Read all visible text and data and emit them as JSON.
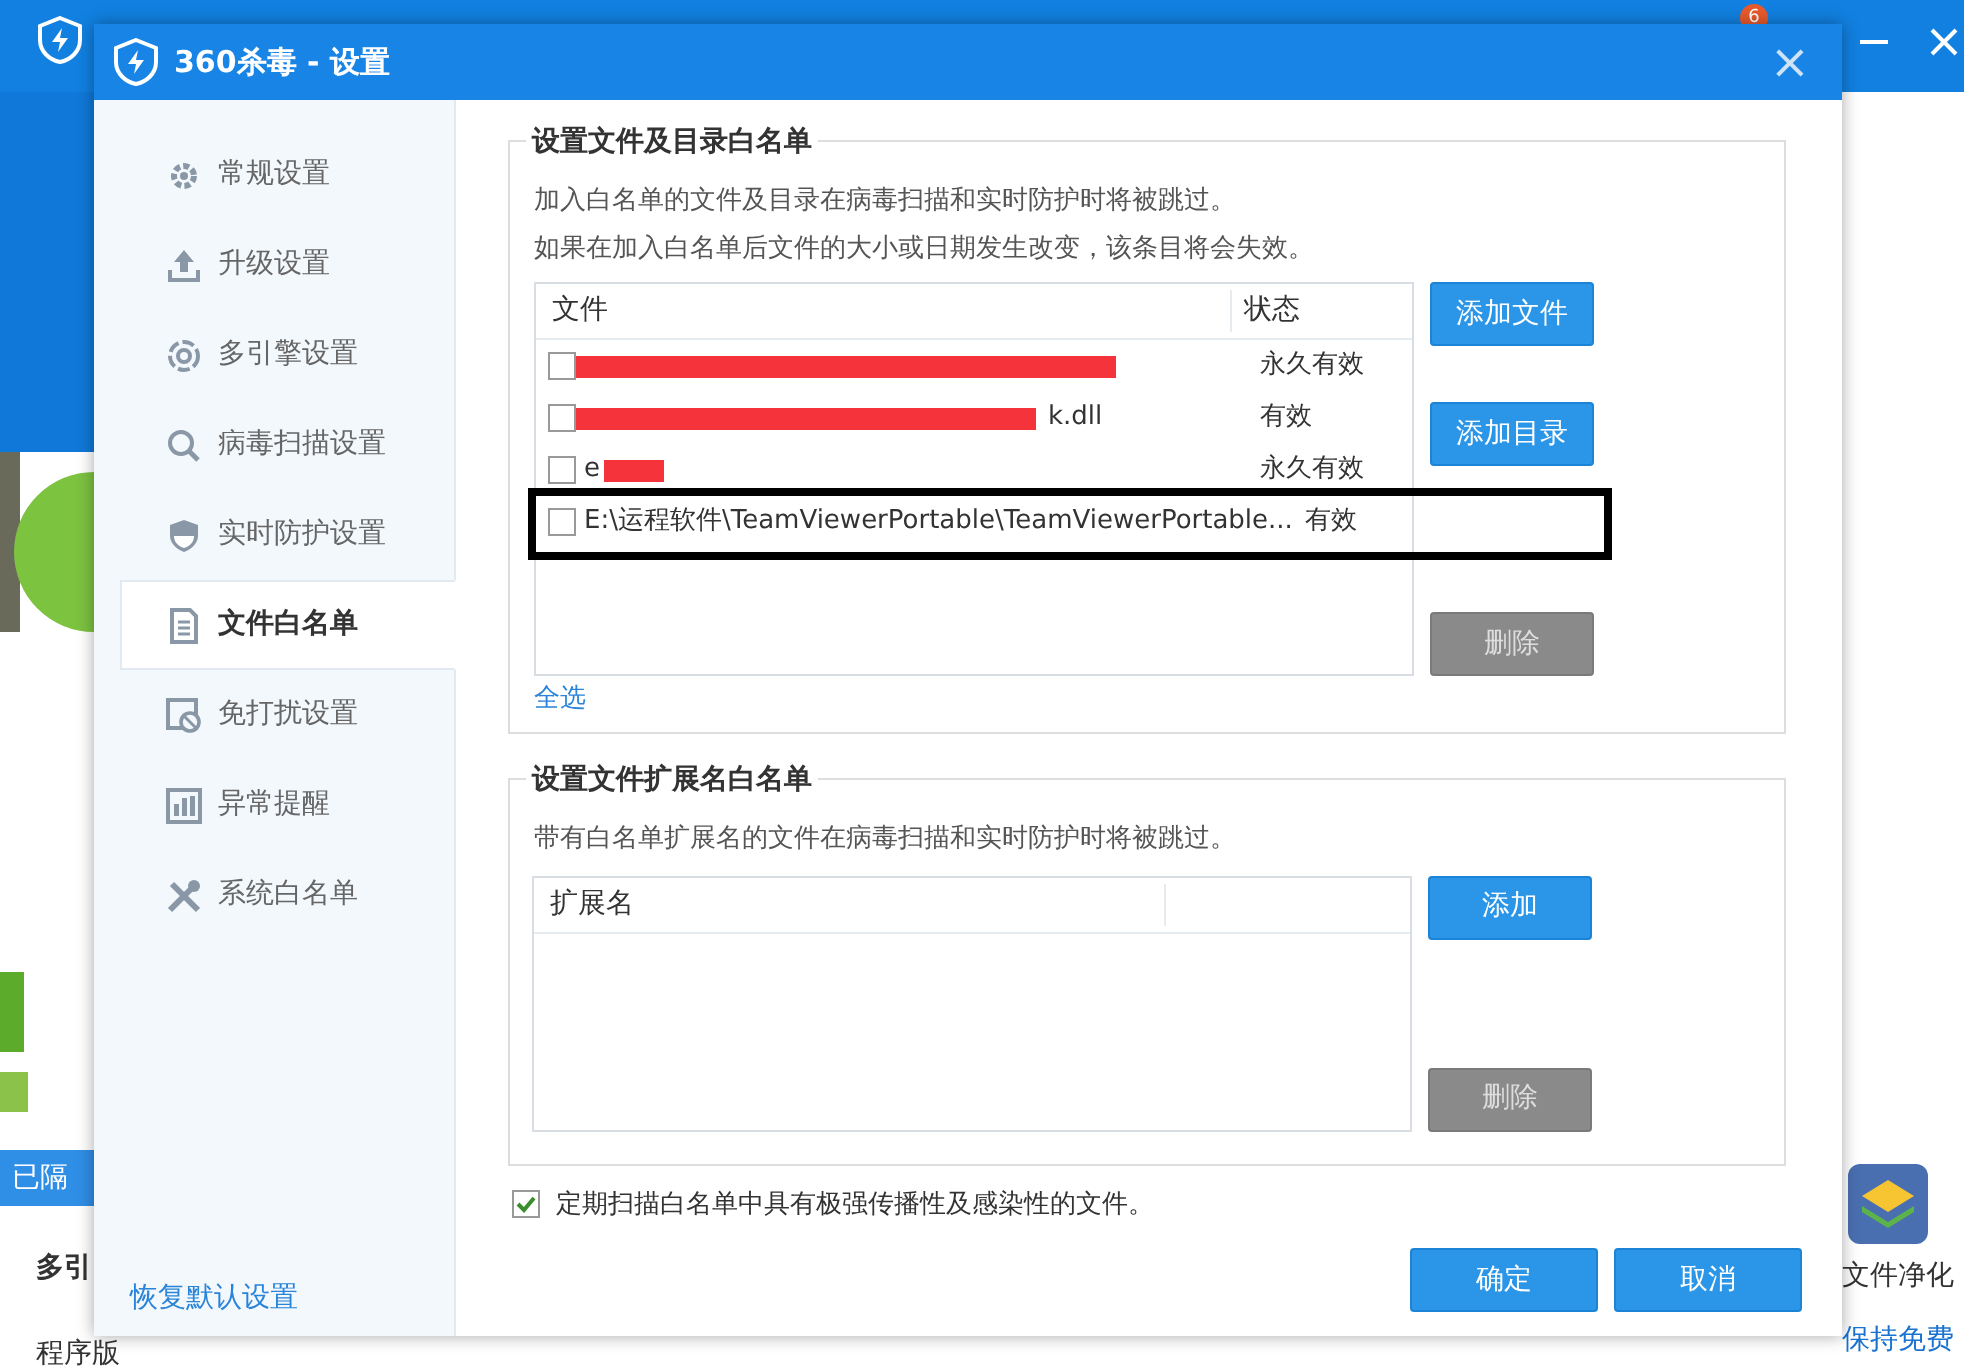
{
  "background_app": {
    "left_texts": [
      "已隔",
      "多引",
      "程序版"
    ],
    "right_texts": [
      "文件净化",
      "保持免费"
    ],
    "badge": "6"
  },
  "window": {
    "title": "360杀毒 - 设置",
    "close": "×"
  },
  "sidebar": {
    "items": [
      {
        "label": "常规设置",
        "selected": false
      },
      {
        "label": "升级设置",
        "selected": false
      },
      {
        "label": "多引擎设置",
        "selected": false
      },
      {
        "label": "病毒扫描设置",
        "selected": false
      },
      {
        "label": "实时防护设置",
        "selected": false
      },
      {
        "label": "文件白名单",
        "selected": true
      },
      {
        "label": "免打扰设置",
        "selected": false
      },
      {
        "label": "异常提醒",
        "selected": false
      },
      {
        "label": "系统白名单",
        "selected": false
      }
    ],
    "restore_link": "恢复默认设置"
  },
  "file_whitelist": {
    "title": "设置文件及目录白名单",
    "description": [
      "加入白名单的文件及目录在病毒扫描和实时防护时将被跳过。",
      "如果在加入白名单后文件的大小或日期发生改变，该条目将会失效。"
    ],
    "table": {
      "columns": [
        "文件",
        "状态"
      ],
      "rows": [
        {
          "checked": false,
          "redacted": true,
          "status": "永久有效",
          "highlighted": false
        },
        {
          "checked": false,
          "name": "k.dll",
          "redacted": true,
          "status": "有效",
          "highlighted": false
        },
        {
          "checked": false,
          "name": "e",
          "redacted": true,
          "status": "永久有效",
          "highlighted": false
        },
        {
          "checked": false,
          "name": "E:\\运程软件\\TeamViewerPortable\\TeamViewerPortable...",
          "redacted": false,
          "status": "有效",
          "highlighted": true
        }
      ]
    },
    "select_all": "全选",
    "buttons": [
      {
        "label": "添加文件",
        "disabled": false
      },
      {
        "label": "添加目录",
        "disabled": false
      },
      {
        "label": "删除",
        "disabled": true
      }
    ]
  },
  "extension_whitelist": {
    "title": "设置文件扩展名白名单",
    "description": "带有白名单扩展名的文件在病毒扫描和实时防护时将被跳过。",
    "table": {
      "columns": [
        "扩展名"
      ]
    },
    "buttons": [
      {
        "label": "添加",
        "disabled": false
      },
      {
        "label": "删除",
        "disabled": true
      }
    ]
  },
  "periodic_scan": {
    "checked": true,
    "label": "定期扫描白名单中具有极强传播性及感染性的文件。"
  },
  "footer_buttons": [
    "确定",
    "取消"
  ]
}
